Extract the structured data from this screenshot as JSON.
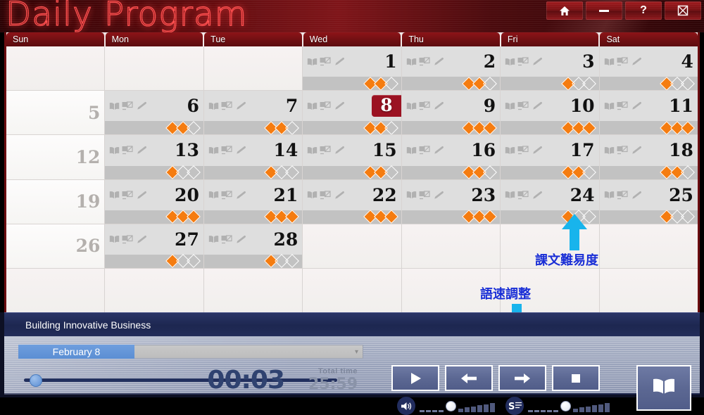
{
  "window": {
    "title": "Daily Program",
    "buttons": [
      {
        "name": "home-button",
        "icon": "home-icon"
      },
      {
        "name": "minimize-button",
        "icon": "minimize-icon"
      },
      {
        "name": "help-button",
        "icon": "help-icon",
        "label": "?"
      },
      {
        "name": "close-button",
        "icon": "close-icon"
      }
    ]
  },
  "calendar": {
    "weekdays": [
      "Sun",
      "Mon",
      "Tue",
      "Wed",
      "Thu",
      "Fri",
      "Sat"
    ],
    "today": 8,
    "lesson_icons": [
      "book-icon",
      "picture-card-icon",
      "pencil-icon"
    ],
    "difficulty_max": 3,
    "weeks": [
      [
        {
          "day": "",
          "type": "blank"
        },
        {
          "day": "",
          "type": "blank"
        },
        {
          "day": "",
          "type": "blank"
        },
        {
          "day": "1",
          "type": "lesson",
          "difficulty": 2
        },
        {
          "day": "2",
          "type": "lesson",
          "difficulty": 2
        },
        {
          "day": "3",
          "type": "lesson",
          "difficulty": 1
        },
        {
          "day": "4",
          "type": "lesson",
          "difficulty": 1
        }
      ],
      [
        {
          "day": "5",
          "type": "sunday",
          "difficulty": 0
        },
        {
          "day": "6",
          "type": "lesson",
          "difficulty": 2
        },
        {
          "day": "7",
          "type": "lesson",
          "difficulty": 2
        },
        {
          "day": "8",
          "type": "lesson",
          "difficulty": 2,
          "today": true
        },
        {
          "day": "9",
          "type": "lesson",
          "difficulty": 3
        },
        {
          "day": "10",
          "type": "lesson",
          "difficulty": 3
        },
        {
          "day": "11",
          "type": "lesson",
          "difficulty": 3
        }
      ],
      [
        {
          "day": "12",
          "type": "sunday",
          "difficulty": 0
        },
        {
          "day": "13",
          "type": "lesson",
          "difficulty": 1
        },
        {
          "day": "14",
          "type": "lesson",
          "difficulty": 1
        },
        {
          "day": "15",
          "type": "lesson",
          "difficulty": 2
        },
        {
          "day": "16",
          "type": "lesson",
          "difficulty": 2
        },
        {
          "day": "17",
          "type": "lesson",
          "difficulty": 2
        },
        {
          "day": "18",
          "type": "lesson",
          "difficulty": 2
        }
      ],
      [
        {
          "day": "19",
          "type": "sunday",
          "difficulty": 0
        },
        {
          "day": "20",
          "type": "lesson",
          "difficulty": 3
        },
        {
          "day": "21",
          "type": "lesson",
          "difficulty": 3
        },
        {
          "day": "22",
          "type": "lesson",
          "difficulty": 3
        },
        {
          "day": "23",
          "type": "lesson",
          "difficulty": 3
        },
        {
          "day": "24",
          "type": "lesson",
          "difficulty": 1
        },
        {
          "day": "25",
          "type": "lesson",
          "difficulty": 1
        }
      ],
      [
        {
          "day": "26",
          "type": "sunday",
          "difficulty": 0
        },
        {
          "day": "27",
          "type": "lesson",
          "difficulty": 1
        },
        {
          "day": "28",
          "type": "lesson",
          "difficulty": 1
        },
        {
          "day": "",
          "type": "blank"
        },
        {
          "day": "",
          "type": "blank"
        },
        {
          "day": "",
          "type": "blank"
        },
        {
          "day": "",
          "type": "blank"
        }
      ],
      [
        {
          "day": "",
          "type": "blank"
        },
        {
          "day": "",
          "type": "blank"
        },
        {
          "day": "",
          "type": "blank"
        },
        {
          "day": "",
          "type": "blank"
        },
        {
          "day": "",
          "type": "blank"
        },
        {
          "day": "",
          "type": "blank"
        },
        {
          "day": "",
          "type": "blank"
        }
      ]
    ]
  },
  "annotations": [
    {
      "name": "difficulty-annotation",
      "text": "課文難易度",
      "color": "#1a2fd6",
      "arrow": "up",
      "arrow_color": "#18b4ec"
    },
    {
      "name": "speed-annotation",
      "text": "語速調整",
      "color": "#1a2fd6",
      "arrow": "down",
      "arrow_color": "#18b4ec"
    }
  ],
  "player": {
    "lesson_title": "Building Innovative Business",
    "date_selector": {
      "value": "February 8",
      "caret": "chevron-down-icon"
    },
    "current_time": "00:03",
    "total_time_label": "Total time",
    "total_time": "25:59",
    "seek_percent": 4,
    "controls": [
      {
        "name": "play-button",
        "icon": "play-icon"
      },
      {
        "name": "previous-button",
        "icon": "arrow-left-icon"
      },
      {
        "name": "next-button",
        "icon": "arrow-right-icon"
      },
      {
        "name": "stop-button",
        "icon": "stop-icon"
      }
    ],
    "volume_slider": {
      "icon": "volume-icon",
      "value": 4,
      "ticks": 10
    },
    "speed_slider": {
      "icon": "speed-icon",
      "value": 5,
      "ticks": 11
    },
    "book_button": {
      "name": "open-book-button",
      "icon": "open-book-icon"
    }
  }
}
